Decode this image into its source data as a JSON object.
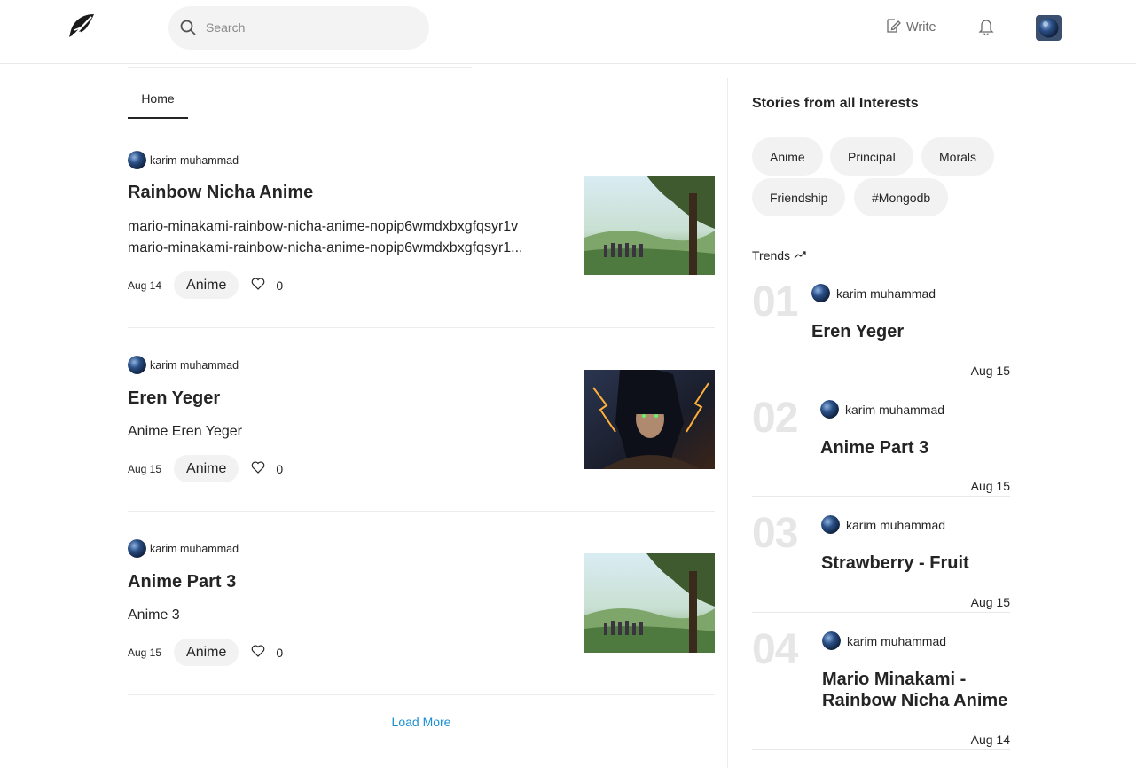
{
  "header": {
    "search_placeholder": "Search",
    "write_label": "Write"
  },
  "tabs": [
    {
      "label": "Home"
    }
  ],
  "posts": [
    {
      "author": "karim muhammad",
      "title": "Rainbow Nicha Anime",
      "description_lines": [
        "mario-minakami-rainbow-nicha-anime-nopip6wmdxbxgfqsyr1v",
        "mario-minakami-rainbow-nicha-anime-nopip6wmdxbxgfqsyr1..."
      ],
      "date": "Aug 14",
      "tag": "Anime",
      "likes": "0",
      "image": "anime-landscape-tree"
    },
    {
      "author": "karim muhammad",
      "title": "Eren Yeger",
      "description_lines": [
        "Anime Eren Yeger"
      ],
      "date": "Aug 15",
      "tag": "Anime",
      "likes": "0",
      "image": "eren-yeager-portrait"
    },
    {
      "author": "karim muhammad",
      "title": "Anime Part 3",
      "description_lines": [
        "Anime 3"
      ],
      "date": "Aug 15",
      "tag": "Anime",
      "likes": "0",
      "image": "anime-landscape-tree"
    }
  ],
  "load_more_label": "Load More",
  "sidebar": {
    "title": "Stories from all Interests",
    "interests": [
      "Anime",
      "Principal",
      "Morals",
      "Friendship",
      "#Mongodb"
    ],
    "trends_label": "Trends",
    "trends": [
      {
        "number": "01",
        "author": "karim muhammad",
        "title_lines": [
          "Eren Yeger"
        ],
        "date": "Aug 15"
      },
      {
        "number": "02",
        "author": "karim muhammad",
        "title_lines": [
          "Anime Part 3"
        ],
        "date": "Aug 15"
      },
      {
        "number": "03",
        "author": "karim muhammad",
        "title_lines": [
          "Strawberry - Fruit"
        ],
        "date": "Aug 15"
      },
      {
        "number": "04",
        "author": "karim muhammad",
        "title_lines": [
          "Mario Minakami -",
          "Rainbow Nicha Anime"
        ],
        "date": "Aug 14"
      }
    ]
  },
  "colors": {
    "accent_link": "#1a8fd0",
    "text": "#242424",
    "pill_bg": "#f2f2f2",
    "trend_number": "#e6e6e6"
  },
  "icons": [
    "feather-logo-icon",
    "search-icon",
    "write-icon",
    "bell-icon",
    "user-avatar",
    "heart-icon",
    "trending-up-icon"
  ]
}
